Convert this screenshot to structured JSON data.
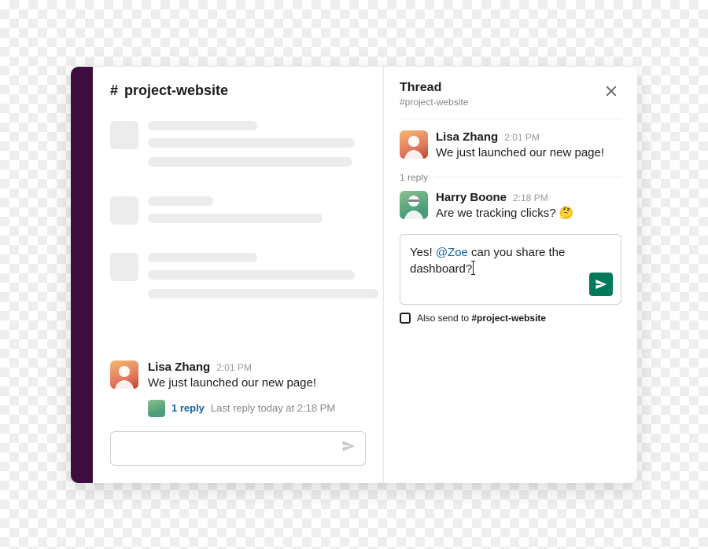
{
  "channel": {
    "hash": "#",
    "name": "project-website"
  },
  "main_message": {
    "author": "Lisa Zhang",
    "time": "2:01 PM",
    "text": "We just launched our new page!",
    "reply_count_label": "1 reply",
    "last_reply_label": "Last reply today at 2:18 PM"
  },
  "thread": {
    "title": "Thread",
    "subtitle": "#project-website",
    "original": {
      "author": "Lisa Zhang",
      "time": "2:01 PM",
      "text": "We just launched our new page!"
    },
    "replies_label": "1 reply",
    "reply": {
      "author": "Harry Boone",
      "time": "2:18 PM",
      "text_before_emoji": "Are we tracking clicks? ",
      "emoji": "🤔"
    },
    "composer": {
      "text_before": "Yes! ",
      "mention": "@Zoe",
      "text_after": " can you share the dashboard?"
    },
    "also_send_prefix": "Also send to ",
    "also_send_channel": "#project-website"
  }
}
